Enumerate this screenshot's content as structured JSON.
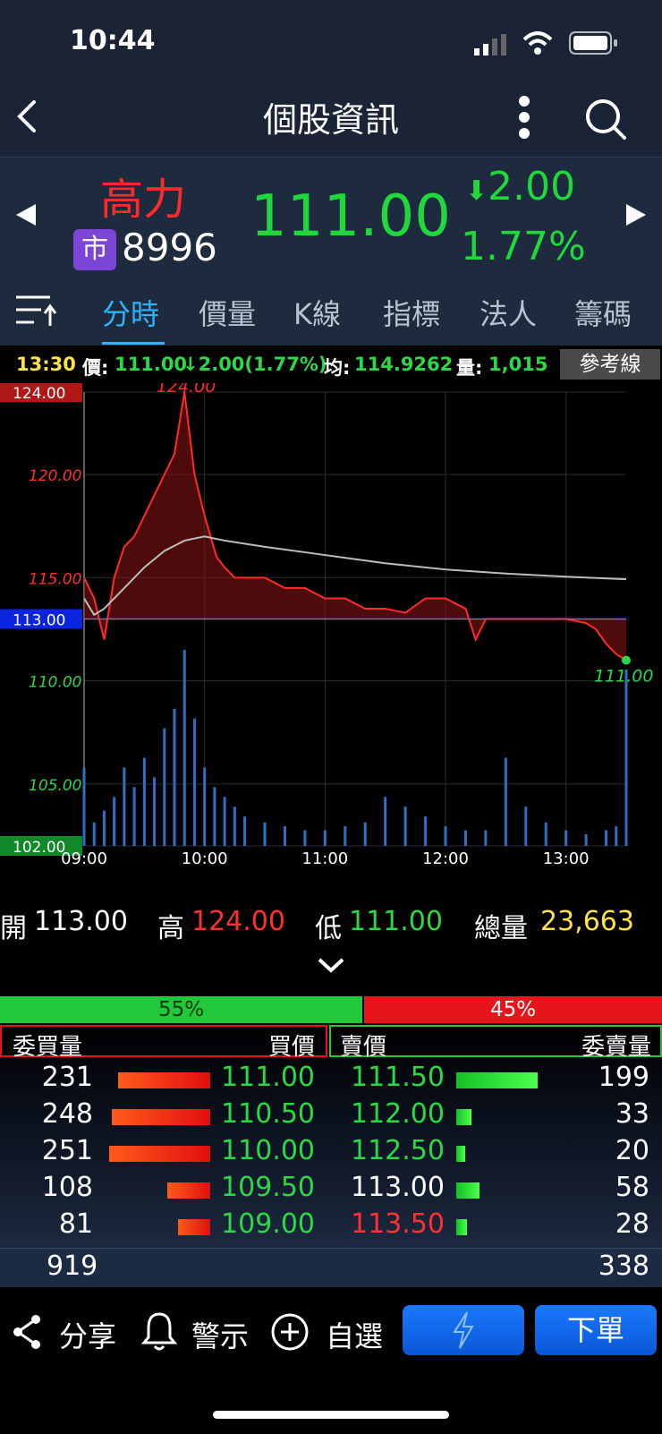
{
  "status": {
    "time": "10:44"
  },
  "header": {
    "title": "個股資訊"
  },
  "stock": {
    "name": "高力",
    "market_badge": "市",
    "code": "8996",
    "price": "111.00",
    "change": "2.00",
    "change_pct": "1.77%"
  },
  "tabs": [
    "分時",
    "價量",
    "K線",
    "指標",
    "法人",
    "籌碼"
  ],
  "info_bar": {
    "time": "13:30",
    "price_label": "價:",
    "price": "111.00",
    "change": "2.00(1.77%)",
    "avg_label": "均:",
    "avg": "114.9262",
    "vol_label": "量:",
    "vol": "1,015",
    "refline_button": "參考線"
  },
  "chart_data": {
    "type": "line",
    "title": "",
    "xlabel": "",
    "ylabel": "",
    "x_ticks": [
      "09:00",
      "10:00",
      "11:00",
      "12:00",
      "13:00"
    ],
    "y_ticks": [
      "124.00",
      "120.00",
      "115.00",
      "113.00",
      "110.00",
      "105.00",
      "102.00"
    ],
    "ylim": [
      102,
      124
    ],
    "reference_price": 113,
    "high_label": "124.00",
    "last_label": "111.00",
    "series": [
      {
        "key": "price",
        "x": [
          0,
          5,
          10,
          15,
          20,
          25,
          30,
          35,
          40,
          45,
          50,
          55,
          60,
          63,
          66,
          70,
          75,
          80,
          90,
          100,
          110,
          120,
          130,
          140,
          150,
          160,
          170,
          180,
          190,
          195,
          200,
          210,
          220,
          230,
          240,
          250,
          255,
          260,
          265,
          270
        ],
        "values": [
          115,
          114,
          112,
          115,
          116.5,
          117,
          118,
          119,
          120,
          121,
          124,
          120,
          118,
          117,
          116,
          115.5,
          115,
          115,
          115,
          114.5,
          114.5,
          114,
          114,
          113.5,
          113.5,
          113.3,
          114,
          114,
          113.5,
          112,
          113,
          113,
          113,
          113,
          113,
          112.8,
          112.5,
          111.8,
          111.3,
          111
        ]
      },
      {
        "key": "average",
        "x": [
          0,
          5,
          10,
          20,
          30,
          40,
          50,
          60,
          70,
          90,
          120,
          150,
          180,
          210,
          240,
          270
        ],
        "values": [
          114,
          113.2,
          113.5,
          114.5,
          115.5,
          116.3,
          116.8,
          117,
          116.8,
          116.5,
          116.1,
          115.7,
          115.4,
          115.2,
          115.05,
          114.9262
        ]
      }
    ],
    "volume": {
      "x": [
        0,
        5,
        10,
        15,
        20,
        25,
        30,
        35,
        40,
        45,
        50,
        55,
        60,
        65,
        70,
        75,
        80,
        90,
        100,
        110,
        120,
        130,
        140,
        150,
        160,
        170,
        180,
        190,
        200,
        210,
        220,
        230,
        240,
        250,
        260,
        265,
        270
      ],
      "values": [
        40,
        12,
        18,
        25,
        40,
        30,
        45,
        35,
        60,
        70,
        100,
        65,
        40,
        30,
        25,
        20,
        15,
        12,
        10,
        8,
        8,
        10,
        12,
        25,
        20,
        15,
        10,
        8,
        8,
        45,
        20,
        12,
        8,
        6,
        8,
        10,
        90
      ]
    }
  },
  "summary": {
    "open_label": "開",
    "open": "113.00",
    "high_label": "高",
    "high": "124.00",
    "low_label": "低",
    "low": "111.00",
    "vol_label": "總量",
    "vol": "23,663"
  },
  "ratio": {
    "buy_pct": 55,
    "sell_pct": 45,
    "buy_label": "55%",
    "sell_label": "45%"
  },
  "orderbook": {
    "headers": {
      "buy_qty": "委買量",
      "buy_price": "買價",
      "sell_price": "賣價",
      "sell_qty": "委賣量"
    },
    "rows": [
      {
        "buy_qty": "231",
        "buy_price": "111.00",
        "sell_price": "111.50",
        "sell_qty": "199",
        "buy_bar": 0.43,
        "sell_bar": 0.38,
        "sell_color": "#2bd845"
      },
      {
        "buy_qty": "248",
        "buy_price": "110.50",
        "sell_price": "112.00",
        "sell_qty": "33",
        "buy_bar": 0.46,
        "sell_bar": 0.07,
        "sell_color": "#2bd845"
      },
      {
        "buy_qty": "251",
        "buy_price": "110.00",
        "sell_price": "112.50",
        "sell_qty": "20",
        "buy_bar": 0.47,
        "sell_bar": 0.04,
        "sell_color": "#2bd845"
      },
      {
        "buy_qty": "108",
        "buy_price": "109.50",
        "sell_price": "113.00",
        "sell_qty": "58",
        "buy_bar": 0.2,
        "sell_bar": 0.11,
        "sell_color": "#ffffff"
      },
      {
        "buy_qty": "81",
        "buy_price": "109.00",
        "sell_price": "113.50",
        "sell_qty": "28",
        "buy_bar": 0.15,
        "sell_bar": 0.05,
        "sell_color": "#ff3030"
      }
    ],
    "totals": {
      "buy": "919",
      "sell": "338"
    }
  },
  "bottom": {
    "share": "分享",
    "alert": "警示",
    "watchlist": "自選",
    "order": "下單"
  }
}
